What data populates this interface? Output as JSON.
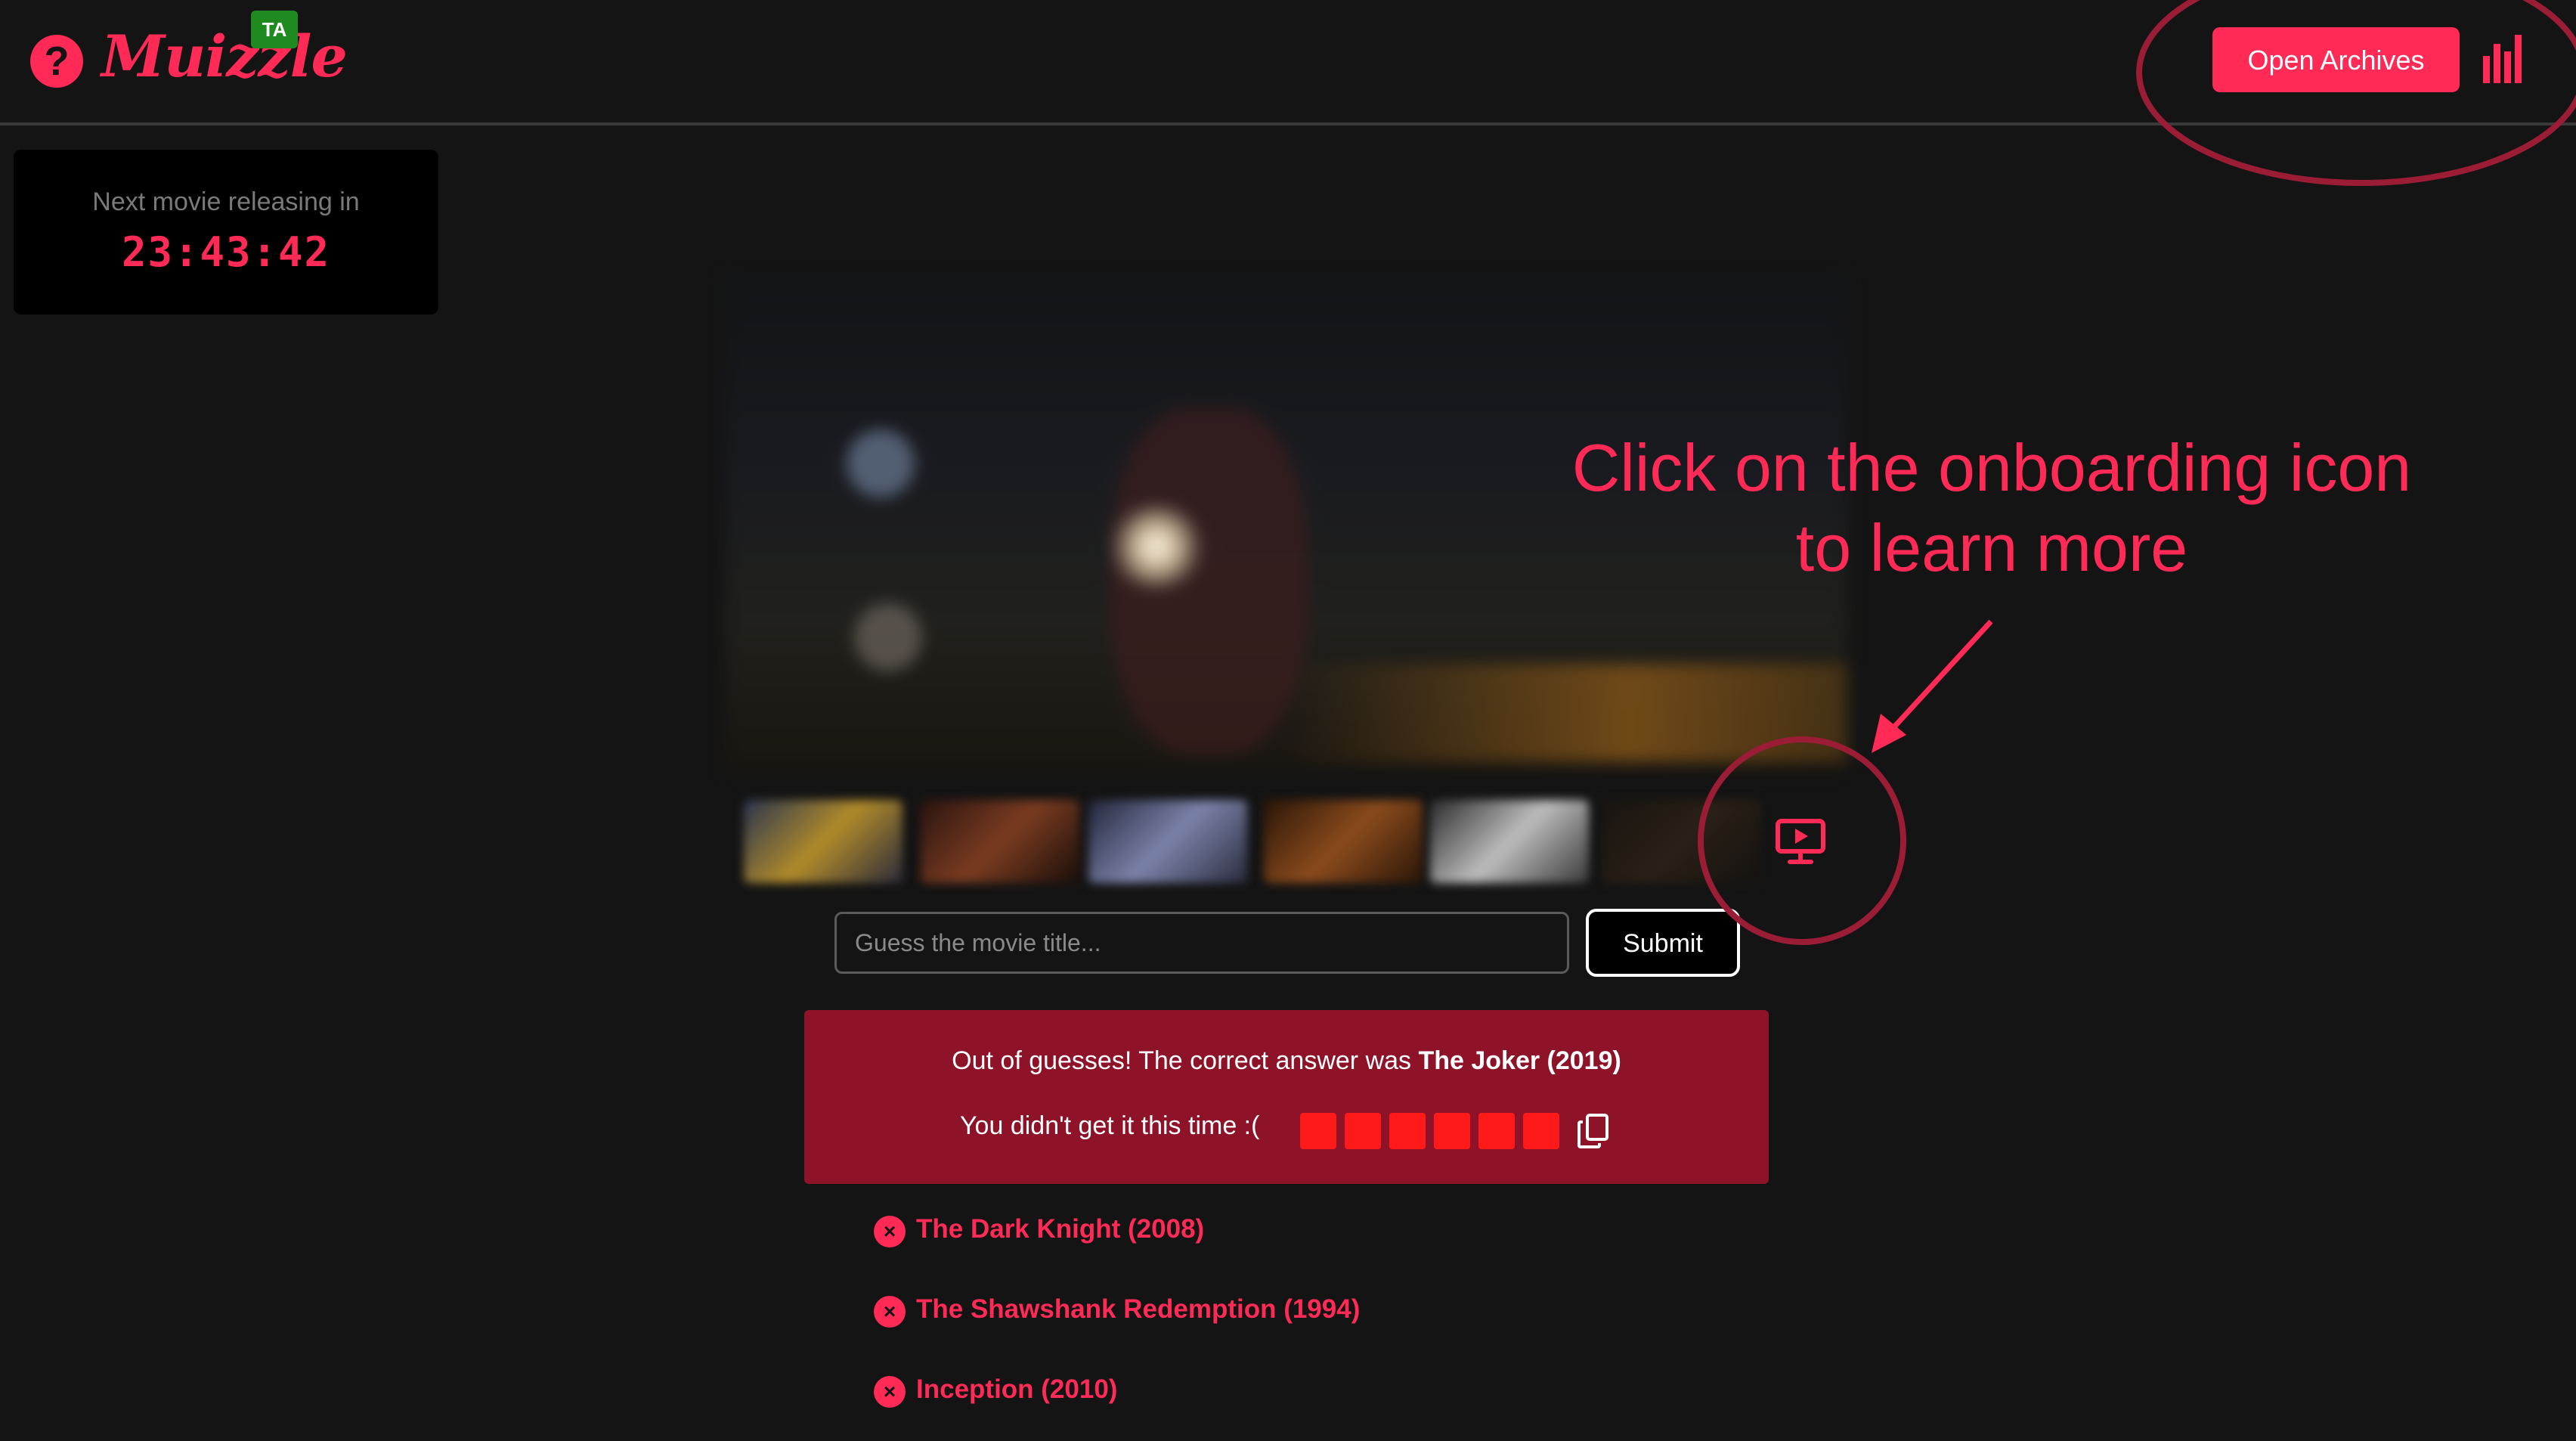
{
  "app": {
    "logo_text": "Muizzle",
    "badge": "TA",
    "help_icon": "question-circle-icon"
  },
  "header": {
    "open_archives_label": "Open Archives",
    "stats_icon": "bar-chart-icon"
  },
  "countdown": {
    "label": "Next movie releasing in",
    "time": "23:43:42"
  },
  "guess_form": {
    "placeholder": "Guess the movie title...",
    "submit_label": "Submit",
    "onboarding_icon": "presentation-play-icon"
  },
  "result": {
    "line1_prefix": "Out of guesses! The correct answer was ",
    "answer": "The Joker (2019)",
    "line2": "You didn't get it this time :(",
    "attempt_squares": [
      "#ff1a1a",
      "#ff1a1a",
      "#ff1a1a",
      "#ff1a1a",
      "#ff1a1a",
      "#ff1a1a"
    ],
    "copy_icon": "copy-icon"
  },
  "guesses": [
    {
      "title": "The Dark Knight (2008)",
      "status_icon": "x-circle-icon"
    },
    {
      "title": "The Shawshank Redemption (1994)",
      "status_icon": "x-circle-icon"
    },
    {
      "title": "Inception (2010)",
      "status_icon": "x-circle-icon"
    }
  ],
  "annotation": {
    "line1": "Click on the onboarding icon",
    "line2": "to learn more"
  },
  "colors": {
    "accent": "#ff2a55",
    "background": "#141414",
    "result_bg": "#8e1228",
    "badge_bg": "#1f8a1f"
  }
}
